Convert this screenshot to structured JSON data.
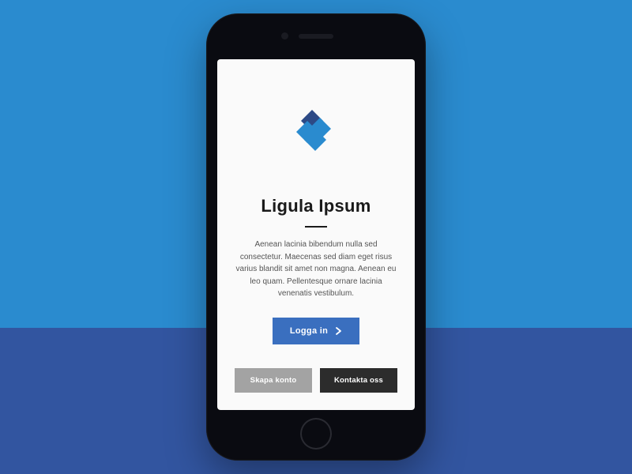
{
  "title": "Ligula Ipsum",
  "description": "Aenean lacinia bibendum nulla sed consectetur. Maecenas sed diam eget risus varius blandit sit amet non magna. Aenean eu leo quam. Pellentesque ornare lacinia venenatis vestibulum.",
  "primary_button": "Logga in",
  "secondary_left": "Skapa konto",
  "secondary_right": "Kontakta oss",
  "colors": {
    "bg_top": "#2a8bcf",
    "bg_bottom": "#3255a0",
    "primary_button": "#3a6fbf",
    "logo_dark": "#2d4a86",
    "logo_light": "#2a8bcf"
  }
}
